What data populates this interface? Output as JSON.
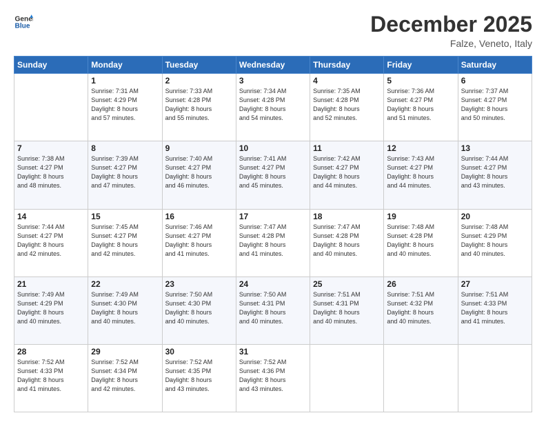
{
  "logo": {
    "line1": "General",
    "line2": "Blue"
  },
  "title": "December 2025",
  "subtitle": "Falze, Veneto, Italy",
  "headers": [
    "Sunday",
    "Monday",
    "Tuesday",
    "Wednesday",
    "Thursday",
    "Friday",
    "Saturday"
  ],
  "weeks": [
    [
      {
        "day": "",
        "info": ""
      },
      {
        "day": "1",
        "info": "Sunrise: 7:31 AM\nSunset: 4:29 PM\nDaylight: 8 hours\nand 57 minutes."
      },
      {
        "day": "2",
        "info": "Sunrise: 7:33 AM\nSunset: 4:28 PM\nDaylight: 8 hours\nand 55 minutes."
      },
      {
        "day": "3",
        "info": "Sunrise: 7:34 AM\nSunset: 4:28 PM\nDaylight: 8 hours\nand 54 minutes."
      },
      {
        "day": "4",
        "info": "Sunrise: 7:35 AM\nSunset: 4:28 PM\nDaylight: 8 hours\nand 52 minutes."
      },
      {
        "day": "5",
        "info": "Sunrise: 7:36 AM\nSunset: 4:27 PM\nDaylight: 8 hours\nand 51 minutes."
      },
      {
        "day": "6",
        "info": "Sunrise: 7:37 AM\nSunset: 4:27 PM\nDaylight: 8 hours\nand 50 minutes."
      }
    ],
    [
      {
        "day": "7",
        "info": "Sunrise: 7:38 AM\nSunset: 4:27 PM\nDaylight: 8 hours\nand 48 minutes."
      },
      {
        "day": "8",
        "info": "Sunrise: 7:39 AM\nSunset: 4:27 PM\nDaylight: 8 hours\nand 47 minutes."
      },
      {
        "day": "9",
        "info": "Sunrise: 7:40 AM\nSunset: 4:27 PM\nDaylight: 8 hours\nand 46 minutes."
      },
      {
        "day": "10",
        "info": "Sunrise: 7:41 AM\nSunset: 4:27 PM\nDaylight: 8 hours\nand 45 minutes."
      },
      {
        "day": "11",
        "info": "Sunrise: 7:42 AM\nSunset: 4:27 PM\nDaylight: 8 hours\nand 44 minutes."
      },
      {
        "day": "12",
        "info": "Sunrise: 7:43 AM\nSunset: 4:27 PM\nDaylight: 8 hours\nand 44 minutes."
      },
      {
        "day": "13",
        "info": "Sunrise: 7:44 AM\nSunset: 4:27 PM\nDaylight: 8 hours\nand 43 minutes."
      }
    ],
    [
      {
        "day": "14",
        "info": "Sunrise: 7:44 AM\nSunset: 4:27 PM\nDaylight: 8 hours\nand 42 minutes."
      },
      {
        "day": "15",
        "info": "Sunrise: 7:45 AM\nSunset: 4:27 PM\nDaylight: 8 hours\nand 42 minutes."
      },
      {
        "day": "16",
        "info": "Sunrise: 7:46 AM\nSunset: 4:27 PM\nDaylight: 8 hours\nand 41 minutes."
      },
      {
        "day": "17",
        "info": "Sunrise: 7:47 AM\nSunset: 4:28 PM\nDaylight: 8 hours\nand 41 minutes."
      },
      {
        "day": "18",
        "info": "Sunrise: 7:47 AM\nSunset: 4:28 PM\nDaylight: 8 hours\nand 40 minutes."
      },
      {
        "day": "19",
        "info": "Sunrise: 7:48 AM\nSunset: 4:28 PM\nDaylight: 8 hours\nand 40 minutes."
      },
      {
        "day": "20",
        "info": "Sunrise: 7:48 AM\nSunset: 4:29 PM\nDaylight: 8 hours\nand 40 minutes."
      }
    ],
    [
      {
        "day": "21",
        "info": "Sunrise: 7:49 AM\nSunset: 4:29 PM\nDaylight: 8 hours\nand 40 minutes."
      },
      {
        "day": "22",
        "info": "Sunrise: 7:49 AM\nSunset: 4:30 PM\nDaylight: 8 hours\nand 40 minutes."
      },
      {
        "day": "23",
        "info": "Sunrise: 7:50 AM\nSunset: 4:30 PM\nDaylight: 8 hours\nand 40 minutes."
      },
      {
        "day": "24",
        "info": "Sunrise: 7:50 AM\nSunset: 4:31 PM\nDaylight: 8 hours\nand 40 minutes."
      },
      {
        "day": "25",
        "info": "Sunrise: 7:51 AM\nSunset: 4:31 PM\nDaylight: 8 hours\nand 40 minutes."
      },
      {
        "day": "26",
        "info": "Sunrise: 7:51 AM\nSunset: 4:32 PM\nDaylight: 8 hours\nand 40 minutes."
      },
      {
        "day": "27",
        "info": "Sunrise: 7:51 AM\nSunset: 4:33 PM\nDaylight: 8 hours\nand 41 minutes."
      }
    ],
    [
      {
        "day": "28",
        "info": "Sunrise: 7:52 AM\nSunset: 4:33 PM\nDaylight: 8 hours\nand 41 minutes."
      },
      {
        "day": "29",
        "info": "Sunrise: 7:52 AM\nSunset: 4:34 PM\nDaylight: 8 hours\nand 42 minutes."
      },
      {
        "day": "30",
        "info": "Sunrise: 7:52 AM\nSunset: 4:35 PM\nDaylight: 8 hours\nand 43 minutes."
      },
      {
        "day": "31",
        "info": "Sunrise: 7:52 AM\nSunset: 4:36 PM\nDaylight: 8 hours\nand 43 minutes."
      },
      {
        "day": "",
        "info": ""
      },
      {
        "day": "",
        "info": ""
      },
      {
        "day": "",
        "info": ""
      }
    ]
  ]
}
